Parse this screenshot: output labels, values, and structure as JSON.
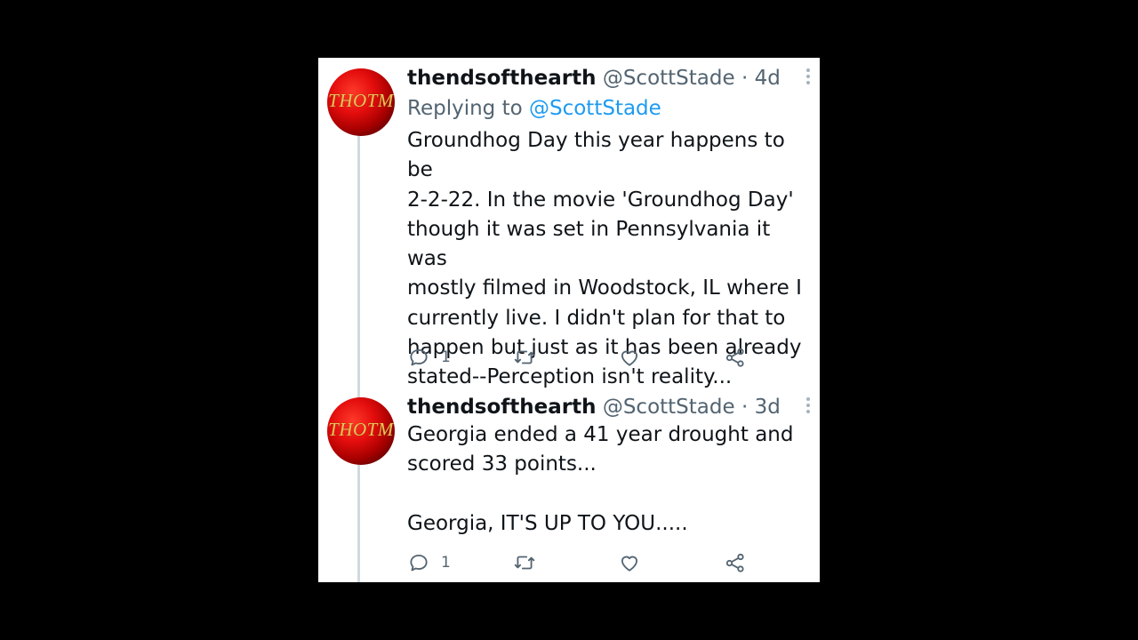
{
  "tweets": [
    {
      "avatar_text": "THOTM",
      "name": "thendsofthearth",
      "handle": "@ScottStade",
      "separator": "·",
      "time": "4d",
      "replying_prefix": "Replying to",
      "replying_to": "@ScottStade",
      "text": "Groundhog Day this year happens to be\n2-2-22. In the movie 'Groundhog Day'\nthough it was set in Pennsylvania it was\nmostly filmed in Woodstock, IL where I\ncurrently live. I didn't plan for that to\nhappen but just as it has been already\nstated--Perception isn't reality...",
      "reply_count": "1"
    },
    {
      "avatar_text": "THOTM",
      "name": "thendsofthearth",
      "handle": "@ScottStade",
      "separator": "·",
      "time": "3d",
      "text": "Georgia ended a 41 year drought and\nscored 33 points...\n\nGeorgia, IT'S UP TO YOU.....",
      "reply_count": "1"
    }
  ],
  "icons": {
    "reply": "reply-icon",
    "retweet": "retweet-icon",
    "like": "heart-icon",
    "share": "share-icon",
    "more": "more-options-icon"
  },
  "colors": {
    "background": "#000000",
    "card": "#ffffff",
    "text_primary": "#0f1419",
    "text_secondary": "#536471",
    "accent": "#1d9bf0",
    "avatar": "#e30d0d"
  }
}
